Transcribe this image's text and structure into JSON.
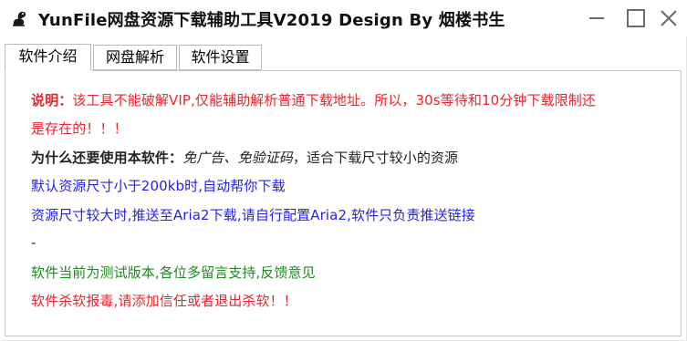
{
  "window": {
    "title": "YunFile网盘资源下载辅助工具V2019  Design By 烟楼书生",
    "icon": "squirrel-app-icon",
    "controls": [
      "minimize-icon",
      "maximize-icon",
      "close-icon"
    ]
  },
  "tabs": [
    {
      "label": "软件介绍",
      "active": true
    },
    {
      "label": "网盘解析",
      "active": false
    },
    {
      "label": "软件设置",
      "active": false
    }
  ],
  "intro": {
    "notice_label": "说明：",
    "notice_text_1": "该工具不能破解VIP,仅能辅助解析普通下载地址。所以，30s等待和10分钟下载限制还",
    "notice_text_2": "是存在的！！！",
    "why_label": "为什么还要使用本软件：",
    "why_reasons": "免广告、免验证码",
    "why_suffix": "，适合下载尺寸较小的资源",
    "auto_download": "默认资源尺寸小于200kb时,自动帮你下载",
    "aria2_push": "资源尺寸较大时,推送至Aria2下载,请自行配置Aria2,软件只负责推送链接",
    "separator": "-",
    "test_version": "软件当前为测试版本,各位多留言支持,反馈意见",
    "antivirus": "软件杀软报毒,请添加信任或者退出杀软！！"
  },
  "colors": {
    "notice": "#e8262b",
    "info": "#2323e6",
    "status": "#1f8a1f",
    "text": "#222222"
  }
}
